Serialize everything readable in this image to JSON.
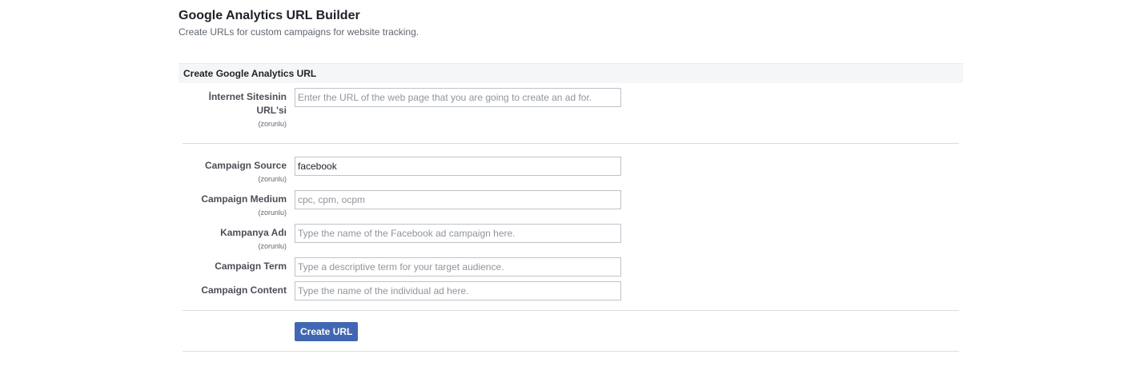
{
  "header": {
    "title": "Google Analytics URL Builder",
    "subtitle": "Create URLs for custom campaigns for website tracking."
  },
  "section": {
    "title": "Create Google Analytics URL"
  },
  "fields": {
    "website_url": {
      "label": "İnternet Sitesinin URL'si",
      "required": "(zorunlu)",
      "value": "",
      "placeholder": "Enter the URL of the web page that you are going to create an ad for."
    },
    "campaign_source": {
      "label": "Campaign Source",
      "required": "(zorunlu)",
      "value": "facebook",
      "placeholder": ""
    },
    "campaign_medium": {
      "label": "Campaign Medium",
      "required": "(zorunlu)",
      "value": "",
      "placeholder": "cpc, cpm, ocpm"
    },
    "campaign_name": {
      "label": "Kampanya Adı",
      "required": "(zorunlu)",
      "value": "",
      "placeholder": "Type the name of the Facebook ad campaign here."
    },
    "campaign_term": {
      "label": "Campaign Term",
      "value": "",
      "placeholder": "Type a descriptive term for your target audience."
    },
    "campaign_content": {
      "label": "Campaign Content",
      "value": "",
      "placeholder": "Type the name of the individual ad here."
    }
  },
  "actions": {
    "create_label": "Create URL"
  },
  "colors": {
    "button": "#4267b2",
    "section_bg": "#f5f6f7"
  }
}
